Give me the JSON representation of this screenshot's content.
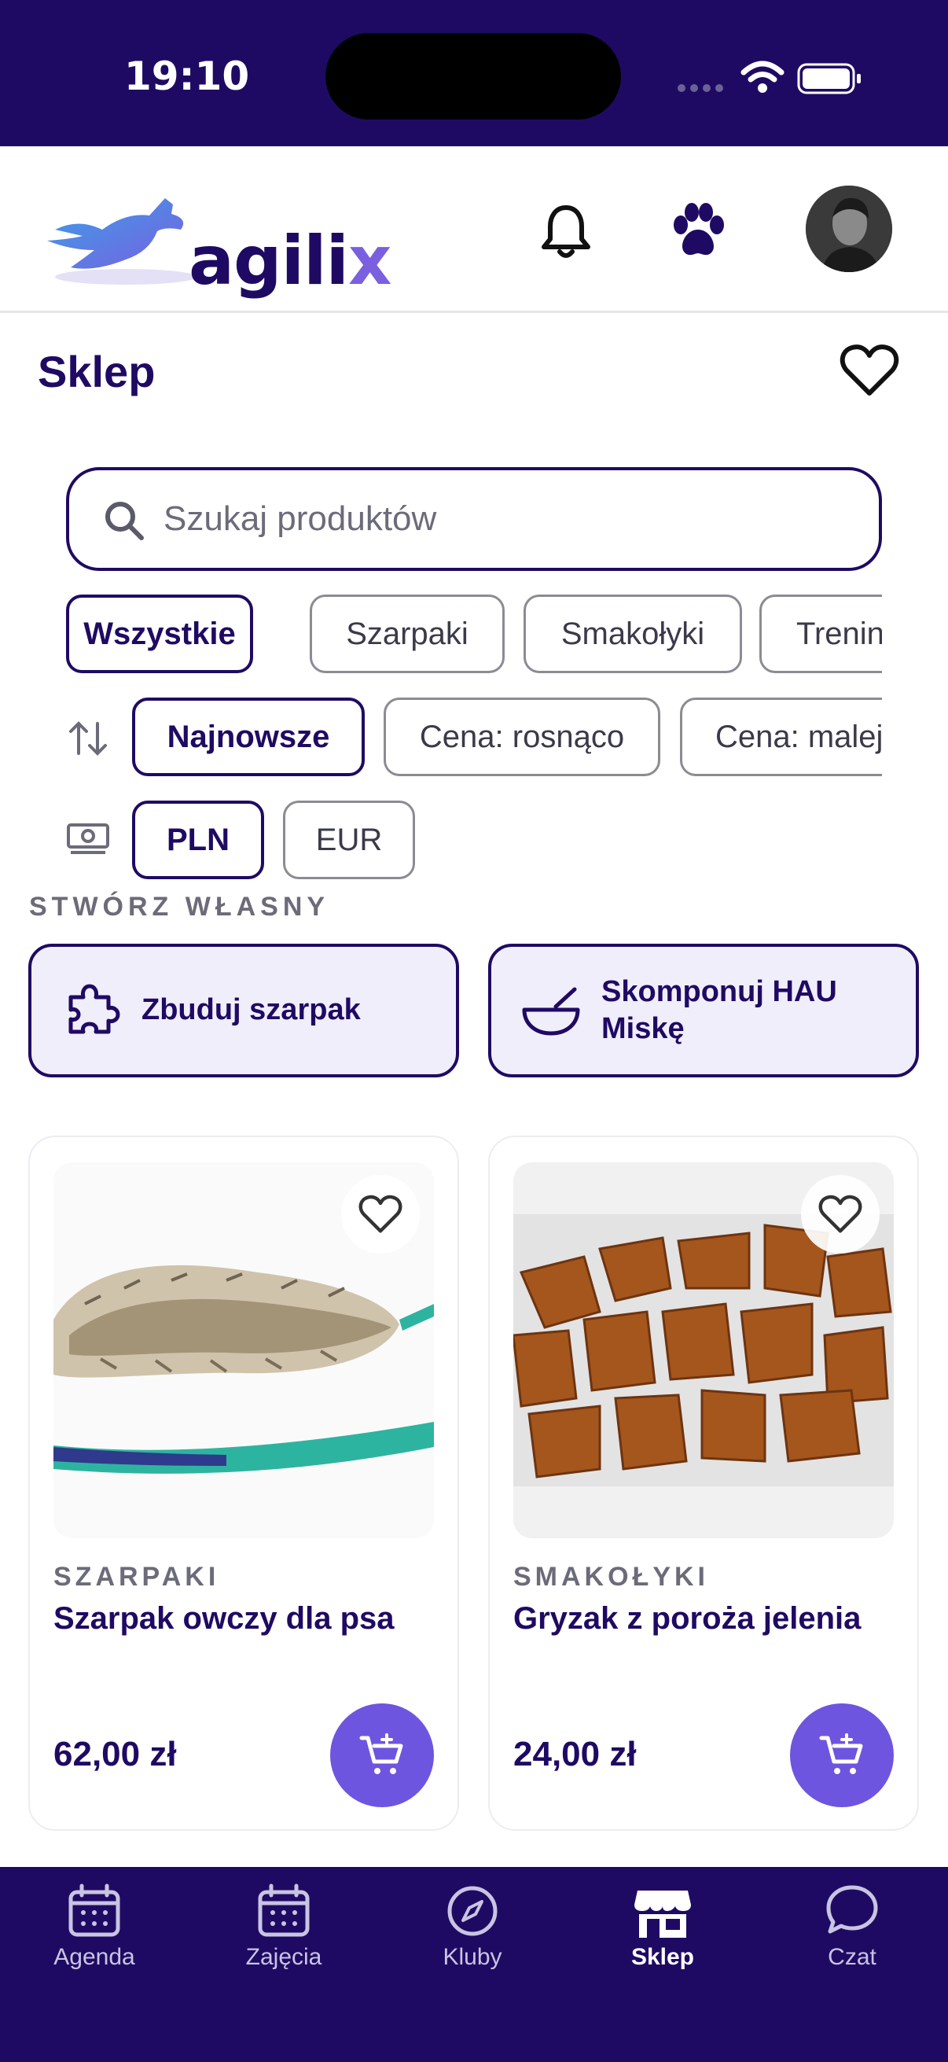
{
  "status_bar": {
    "time": "19:10"
  },
  "header": {
    "logo_text": "agili",
    "logo_text_accent": "x",
    "icons": [
      "bell-icon",
      "paw-icon"
    ],
    "avatar": "profile-avatar"
  },
  "page": {
    "title": "Sklep"
  },
  "search": {
    "placeholder": "Szukaj produktów"
  },
  "category_chips": [
    {
      "label": "Wszystkie",
      "active": true
    },
    {
      "label": "Szarpaki",
      "active": false
    },
    {
      "label": "Smakołyki",
      "active": false
    },
    {
      "label": "Trenin",
      "active": false
    }
  ],
  "sort_chips": [
    {
      "label": "Najnowsze",
      "active": true
    },
    {
      "label": "Cena: rosnąco",
      "active": false
    },
    {
      "label": "Cena: malej",
      "active": false
    }
  ],
  "currency_chips": [
    {
      "label": "PLN",
      "active": true
    },
    {
      "label": "EUR",
      "active": false
    }
  ],
  "create_section": {
    "label": "STWÓRZ WŁASNY",
    "build_tug": "Zbuduj szarpak",
    "compose_bowl_line1": "Skomponuj HAU",
    "compose_bowl_line2": "Miskę"
  },
  "products": [
    {
      "category": "SZARPAKI",
      "name": "Szarpak owczy dla psa",
      "price": "62,00 zł"
    },
    {
      "category": "SMAKOŁYKI",
      "name": "Gryzak z poroża jelenia",
      "price": "24,00 zł"
    }
  ],
  "bottom_nav": [
    {
      "label": "Agenda",
      "active": false
    },
    {
      "label": "Zajęcia",
      "active": false
    },
    {
      "label": "Kluby",
      "active": false
    },
    {
      "label": "Sklep",
      "active": true
    },
    {
      "label": "Czat",
      "active": false
    }
  ],
  "colors": {
    "primary": "#1f0a63",
    "accent": "#6e55df",
    "tint": "#f1eefc"
  }
}
